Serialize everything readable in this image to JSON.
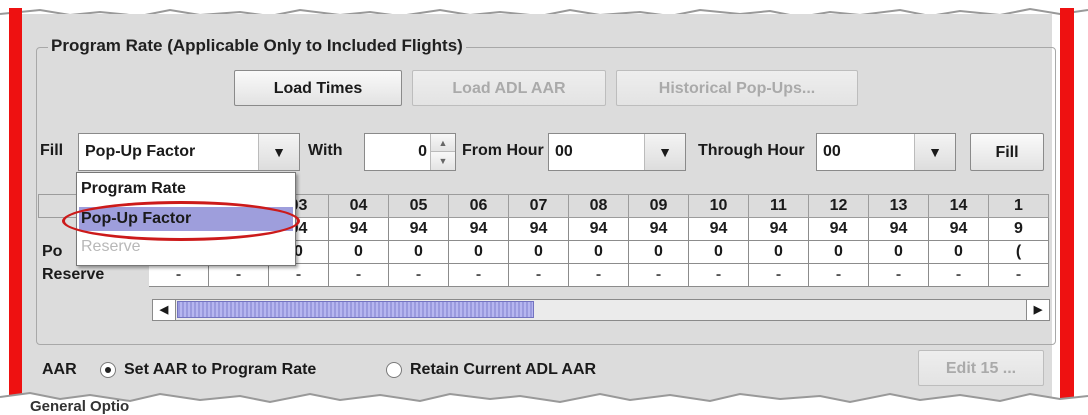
{
  "group": {
    "title": "Program Rate (Applicable Only to Included Flights)"
  },
  "buttons": {
    "load_times": "Load Times",
    "load_adl_aar": "Load ADL AAR",
    "historical_popups": "Historical Pop-Ups...",
    "fill": "Fill",
    "edit15": "Edit 15 ..."
  },
  "fill_row": {
    "fill_label": "Fill",
    "fill_combo_value": "Pop-Up Factor",
    "with_label": "With",
    "with_value": "0",
    "from_hour_label": "From Hour",
    "from_hour_value": "00",
    "through_hour_label": "Through Hour",
    "through_hour_value": "00"
  },
  "dropdown": {
    "options": [
      "Program Rate",
      "Pop-Up Factor",
      "Reserve"
    ],
    "selected": "Pop-Up Factor"
  },
  "grid": {
    "hours": [
      "03",
      "04",
      "05",
      "06",
      "07",
      "08",
      "09",
      "10",
      "11",
      "12",
      "13",
      "14",
      "1"
    ],
    "row2_values": [
      "94",
      "94",
      "94",
      "94",
      "94",
      "94",
      "94",
      "94",
      "94",
      "94",
      "94",
      "94",
      "9"
    ],
    "row3_values": [
      "0",
      "0",
      "0",
      "0",
      "0",
      "0",
      "0",
      "0",
      "0",
      "0",
      "0",
      "0",
      "("
    ],
    "row_labels": {
      "popup_partial": "Po",
      "reserve": "Reserve"
    },
    "reserve_cell": "-"
  },
  "aar": {
    "label": "AAR",
    "option_set": "Set AAR to Program Rate",
    "option_retain": "Retain Current ADL AAR",
    "selected": "set"
  },
  "footer": {
    "partial_section": "General Optio"
  }
}
